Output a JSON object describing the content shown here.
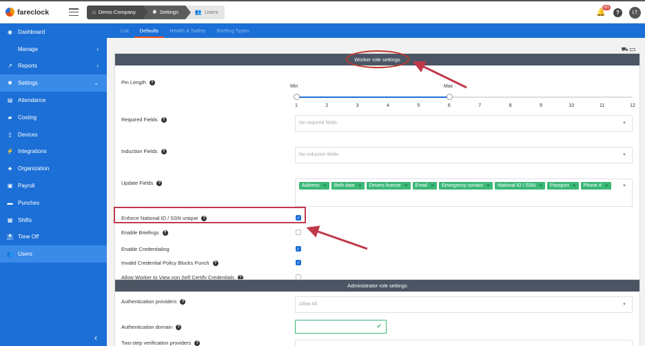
{
  "app": {
    "name": "fareclock"
  },
  "breadcrumb": [
    {
      "label": "Demo Company",
      "icon": "home-icon"
    },
    {
      "label": "Settings",
      "icon": "gear-icon"
    },
    {
      "label": "Users",
      "icon": "users-icon"
    }
  ],
  "topbar": {
    "notification_count": "281",
    "help_label": "?",
    "avatar_initials": "LT"
  },
  "sidebar": {
    "items": [
      {
        "label": "Dashboard",
        "icon": "dashboard-icon"
      },
      {
        "label": "Manage",
        "icon": "person-icon",
        "chevron": "‹"
      },
      {
        "label": "Reports",
        "icon": "chart-icon",
        "chevron": "‹"
      },
      {
        "label": "Settings",
        "icon": "gear-icon",
        "chevron": "⌄"
      },
      {
        "label": "Attendance",
        "icon": "attendance-icon"
      },
      {
        "label": "Costing",
        "icon": "folder-icon"
      },
      {
        "label": "Devices",
        "icon": "tablet-icon"
      },
      {
        "label": "Integrations",
        "icon": "plug-icon"
      },
      {
        "label": "Organization",
        "icon": "org-icon"
      },
      {
        "label": "Payroll",
        "icon": "money-icon"
      },
      {
        "label": "Punches",
        "icon": "truck-icon"
      },
      {
        "label": "Shifts",
        "icon": "calendar-icon"
      },
      {
        "label": "Time Off",
        "icon": "beach-icon"
      },
      {
        "label": "Users",
        "icon": "users-icon"
      }
    ],
    "collapse_label": "‹"
  },
  "subtabs": [
    "List",
    "Defaults",
    "Health & Safety",
    "Briefing Types"
  ],
  "worker_section": {
    "title": "Worker role settings",
    "pin_length": {
      "label": "Pin Length",
      "min_label": "Min",
      "max_label": "Max",
      "ticks": [
        "1",
        "2",
        "3",
        "4",
        "5",
        "6",
        "7",
        "8",
        "9",
        "10",
        "11",
        "12"
      ],
      "min_value": 1,
      "max_value": 6
    },
    "required_fields": {
      "label": "Required Fields",
      "placeholder": "No required fields"
    },
    "induction_fields": {
      "label": "Induction Fields",
      "placeholder": "No induction fields"
    },
    "update_fields": {
      "label": "Update Fields",
      "tags": [
        "Address",
        "Birth date",
        "Drivers license",
        "Email",
        "Emergency contact",
        "National ID / SSN",
        "Passport",
        "Phone #"
      ]
    },
    "checkboxes": [
      {
        "label": "Enforce National ID / SSN unique",
        "checked": true,
        "help": true
      },
      {
        "label": "Enable Briefings",
        "checked": false,
        "help": true
      },
      {
        "label": "Enable Credentialing",
        "checked": true,
        "help": false
      },
      {
        "label": "Invalid Credential Policy Blocks Punch",
        "checked": true,
        "help": true
      },
      {
        "label": "Allow Worker to View non Self Certify Credentials",
        "checked": false,
        "help": true
      }
    ]
  },
  "admin_section": {
    "title": "Administrator role settings",
    "auth_providers": {
      "label": "Authentication providers",
      "value": "Allow All"
    },
    "auth_domain": {
      "label": "Authentication domain",
      "value": ""
    },
    "two_step": {
      "label": "Two-step verification providers"
    }
  },
  "colors": {
    "sidebar": "#1b6fd6",
    "accent": "#e94e1b",
    "tag": "#3cb878",
    "header": "#4b5563",
    "annotation": "#c0392b"
  }
}
